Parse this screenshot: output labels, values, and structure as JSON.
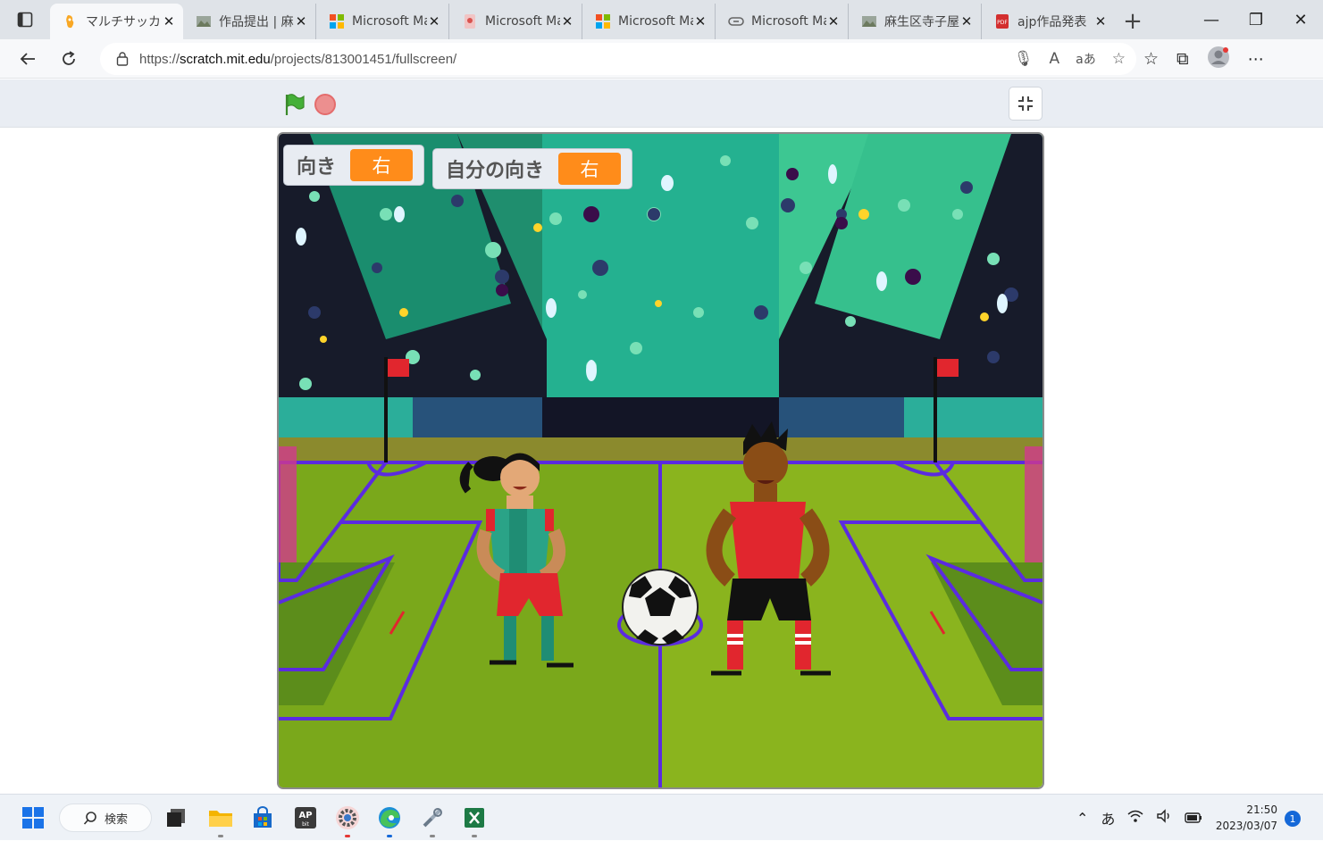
{
  "browser": {
    "tabs": [
      {
        "title": "マルチサッカーゲ",
        "icon": "scratch-icon",
        "active": true
      },
      {
        "title": "作品提出 | 麻",
        "icon": "site-icon",
        "active": false
      },
      {
        "title": "Microsoft Ma",
        "icon": "microsoft-icon",
        "active": false
      },
      {
        "title": "Microsoft Ma",
        "icon": "microsoft-icon",
        "active": false
      },
      {
        "title": "Microsoft Ma",
        "icon": "microsoft-icon",
        "active": false
      },
      {
        "title": "Microsoft Ma",
        "icon": "link-icon",
        "active": false
      },
      {
        "title": "麻生区寺子屋",
        "icon": "site-icon",
        "active": false
      },
      {
        "title": "ajp作品発表",
        "icon": "pdf-icon",
        "active": false
      }
    ],
    "url_prefix": "https://",
    "url_domain": "scratch.mit.edu",
    "url_path": "/projects/813001451/fullscreen/"
  },
  "stage": {
    "monitors": [
      {
        "label": "向き",
        "value": "右"
      },
      {
        "label": "自分の向き",
        "value": "右"
      }
    ]
  },
  "taskbar": {
    "search_label": "検索",
    "apps": [
      "start-icon",
      "task-view-icon",
      "file-explorer-icon",
      "store-icon",
      "ap-app-icon",
      "settings-icon",
      "edge-icon",
      "tools-icon",
      "excel-icon"
    ],
    "ime": "あ",
    "time": "21:50",
    "date": "2023/03/07",
    "notifications": "1"
  },
  "colors": {
    "monitor_value": "#ff8c1a",
    "grass_light": "#8ab41e",
    "grass_dark": "#5c8d1b",
    "field_lines": "#5b2be0",
    "crowd_teal": "#2bb99a"
  }
}
